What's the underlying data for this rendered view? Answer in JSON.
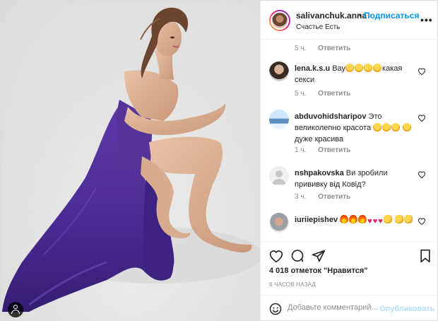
{
  "header": {
    "username": "salivanchuk.anna",
    "dot": "•",
    "follow_label": "Подписаться",
    "location": "Счастье Есть",
    "more_label": "•••"
  },
  "comments": [
    {
      "meta_time": "5 ч.",
      "reply_label": "Ответить"
    },
    {
      "author": "lena.k.s.u",
      "text_before": "Вау",
      "emojis": [
        "face",
        "face",
        "face",
        "face"
      ],
      "text_after": "какая секси",
      "time": "5 ч.",
      "reply_label": "Ответить"
    },
    {
      "author": "abduvohidsharipov",
      "text_before": "Это великолепно красота",
      "emojis": [
        "face",
        "face",
        "face",
        "face"
      ],
      "text_after": "дуже красива",
      "time": "1 ч.",
      "reply_label": "Ответить"
    },
    {
      "author": "nshpakovska",
      "text_before": "Ви зробили прививку від Ковід?",
      "time": "3 ч.",
      "reply_label": "Ответить"
    },
    {
      "author": "iuriiepishev",
      "emojis": [
        "fire",
        "fire",
        "fire",
        "heart",
        "heart",
        "heart",
        "clap",
        "clap",
        "clap"
      ]
    }
  ],
  "actions": {
    "likes": "4 018 отметок \"Нравится\"",
    "posted": "6 ЧАСОВ НАЗАД"
  },
  "add_comment": {
    "placeholder": "Добавьте комментарий...",
    "publish_label": "Опубликовать"
  },
  "icons": {
    "like": "heart-outline-icon",
    "comment": "speech-bubble-icon",
    "share": "paper-plane-icon",
    "save": "bookmark-icon",
    "emoji": "smiley-icon",
    "tag": "person-tag-icon"
  },
  "colors": {
    "accent": "#0095f6",
    "dress": "#4b2b92",
    "publish_disabled": "#b2dffc"
  }
}
